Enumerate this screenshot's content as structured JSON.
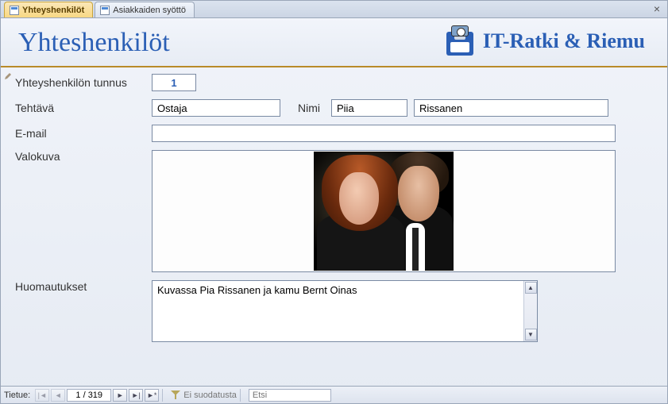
{
  "tabs": [
    {
      "label": "Yhteyshenkilöt",
      "active": true
    },
    {
      "label": "Asiakkaiden syöttö",
      "active": false
    }
  ],
  "header": {
    "title": "Yhteshenkilöt",
    "brand": "IT-Ratki & Riemu"
  },
  "form": {
    "labels": {
      "id": "Yhteyshenkilön tunnus",
      "role": "Tehtävä",
      "name": "Nimi",
      "email": "E-mail",
      "photo": "Valokuva",
      "notes": "Huomautukset"
    },
    "values": {
      "id": "1",
      "role": "Ostaja",
      "first_name": "Piia",
      "last_name": "Rissanen",
      "email": "",
      "notes": "Kuvassa Pia Rissanen ja kamu Bernt Oinas"
    }
  },
  "nav": {
    "record_label": "Tietue:",
    "position": "1 / 319",
    "filter_text": "Ei suodatusta",
    "search_placeholder": "Etsi",
    "icons": {
      "first": "|◄",
      "prev": "◄",
      "next": "►",
      "last": "►|",
      "new": "►*"
    }
  }
}
